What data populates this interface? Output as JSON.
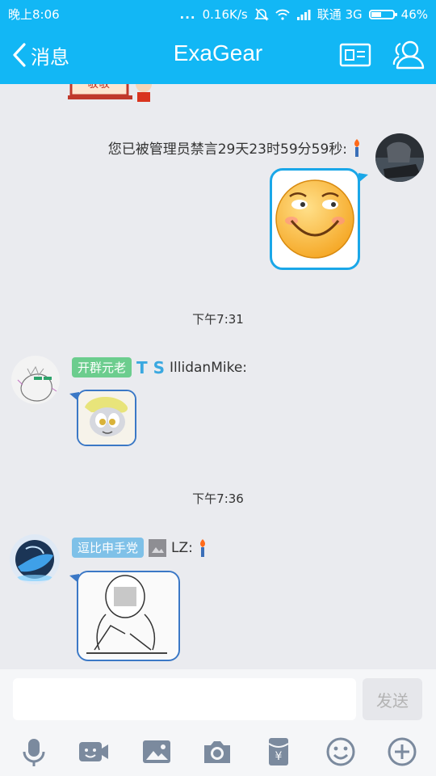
{
  "status": {
    "time": "晚上8:06",
    "dots": "...",
    "speed": "0.16K/s",
    "carrier": "联通 3G",
    "battery": "46%",
    "battery_level": 0.46
  },
  "nav": {
    "back_label": "消息",
    "title": "ExaGear"
  },
  "messages": {
    "self_notice": "您已被管理员禁言29天23时59分59秒:",
    "time1": "下午7:31",
    "user1": {
      "badge": "开群元老",
      "icon_letters": "T S",
      "name": "IllidanMike:"
    },
    "time2": "下午7:36",
    "user2": {
      "badge": "逗比申手党",
      "name": "LZ:"
    }
  },
  "input": {
    "placeholder": "",
    "send_label": "发送"
  },
  "colors": {
    "brand": "#12b7f5",
    "badge_green": "#6ccd8e",
    "badge_blue": "#7fc1e8",
    "bubble_out_border": "#1aa7e8",
    "bubble_in_border": "#3b78c6"
  },
  "icons": {
    "toolbar": [
      "microphone-icon",
      "video-icon",
      "image-icon",
      "camera-icon",
      "red-packet-icon",
      "emoji-icon",
      "plus-icon"
    ]
  }
}
